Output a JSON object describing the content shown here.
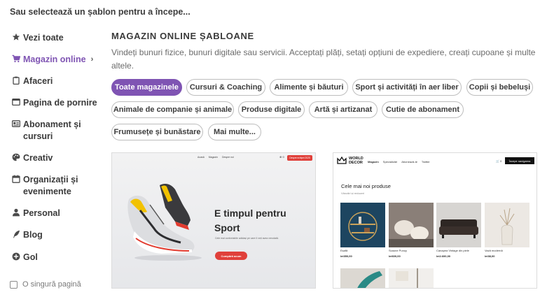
{
  "prompt": "Sau selectează un șablon pentru a începe...",
  "sidebar": {
    "items": [
      {
        "label": "Vezi toate",
        "icon": "star-icon"
      },
      {
        "label": "Magazin online",
        "icon": "cart-icon",
        "active": true
      },
      {
        "label": "Afaceri",
        "icon": "clipboard-icon"
      },
      {
        "label": "Pagina de pornire",
        "icon": "browser-icon"
      },
      {
        "label": "Abonament și cursuri",
        "icon": "id-card-icon"
      },
      {
        "label": "Creativ",
        "icon": "palette-icon"
      },
      {
        "label": "Organizații și evenimente",
        "icon": "calendar-icon"
      },
      {
        "label": "Personal",
        "icon": "person-icon"
      },
      {
        "label": "Blog",
        "icon": "quill-icon"
      },
      {
        "label": "Gol",
        "icon": "plus-circle-icon"
      }
    ],
    "active_chevron": "›",
    "single_page_label": "O singură pagină"
  },
  "main": {
    "title": "MAGAZIN ONLINE ȘABLOANE",
    "description": "Vindeți bunuri fizice, bunuri digitale sau servicii. Acceptați plăți, setați opțiuni de expediere, creați cupoane și multe altele.",
    "filters": [
      "Toate magazinele",
      "Cursuri & Coaching",
      "Alimente și băuturi",
      "Sport și activități în aer liber",
      "Copii și bebeluși",
      "Animale de companie și animale",
      "Produse digitale",
      "Artă și artizanat",
      "Cutie de abonament",
      "Frumusețe și bunăstare",
      "Mai multe..."
    ],
    "active_filter": "Toate magazinele"
  },
  "templates": {
    "sport": {
      "nav": [
        "Acasă",
        "Magazin",
        "Despre noi"
      ],
      "cart": "⊕ 0",
      "nav_button": "Despre echipei 2025",
      "headline": "E timpul pentru Sport",
      "subtext": "Cele mai confortabile adidași pe care îi veți avea vreodată.",
      "cta": "Cumpără acum",
      "accent_color": "#e0403a"
    },
    "decor": {
      "logo": [
        "WORLD",
        "DECOR"
      ],
      "nav": [
        "Magazin",
        "Specializări",
        "Abonează-te",
        "Twitter"
      ],
      "cart": "🛒 0",
      "nav_button": "Începe navigarea",
      "heading": "Cele mai noi produse",
      "subheading": "Vânzări și reduceri",
      "products": [
        {
          "name": "Eșafă",
          "price": "lei350,00"
        },
        {
          "name": "Scaune Punuy",
          "price": "lei600,00"
        },
        {
          "name": "Canapea Vintage din piele",
          "price": "lei2.600,00"
        },
        {
          "name": "Vază modernă",
          "price": "lei38,00"
        }
      ]
    }
  },
  "colors": {
    "accent": "#7f54b3",
    "text": "#3a3a3a",
    "muted": "#6b6b6b"
  }
}
